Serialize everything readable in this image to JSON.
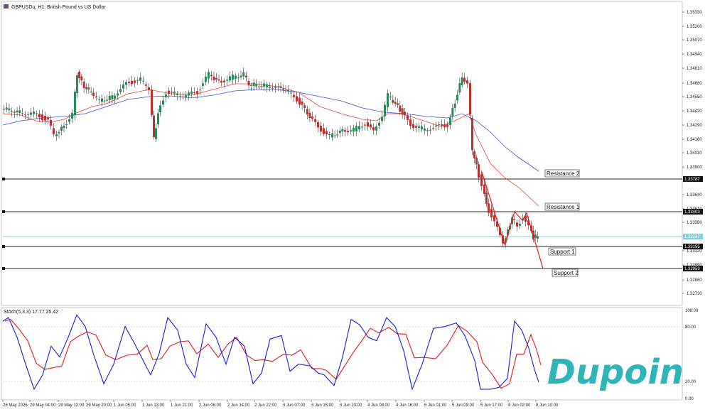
{
  "header": {
    "symbol_title": "GBPUSDu, H1: British Pound vs US Dollar"
  },
  "oscillator": {
    "title": "Stoch(5,3,3) 17.77 25.42",
    "levels": [
      "100.00",
      "80.00",
      "20.00",
      "0.00"
    ]
  },
  "price_axis": {
    "ticks": [
      "1.35330",
      "1.35200",
      "1.35070",
      "1.34940",
      "1.34810",
      "1.34680",
      "1.34550",
      "1.34420",
      "1.34290",
      "1.34160",
      "1.34030",
      "1.33900",
      "1.33640",
      "1.33510",
      "1.33380",
      "1.33120",
      "1.32990",
      "1.32860",
      "1.32730"
    ]
  },
  "level_labels": {
    "resistance2_price": "1.33787",
    "resistance1_price": "1.33403",
    "current_price": "1.33247",
    "support1_price": "1.33155",
    "support2_price": "1.32953"
  },
  "annotations": {
    "resistance2": "Resistance 2",
    "resistance1": "Resistance 1",
    "support1": "Support 1",
    "support2": "Support 2"
  },
  "time_axis": {
    "ticks": [
      "28 May 2026",
      "29 May 04:00",
      "29 May 12:00",
      "29 May 20:00",
      "1 Jun 05:00",
      "1 Jun 13:00",
      "1 Jun 21:00",
      "2 Jun 06:00",
      "2 Jun 14:00",
      "2 Jun 22:00",
      "3 Jun 07:00",
      "3 Jun 15:00",
      "3 Jun 23:00",
      "4 Jun 08:00",
      "4 Jun 16:00",
      "5 Jun 01:00",
      "5 Jun 09:00",
      "5 Jun 17:00",
      "8 Jun 02:00",
      "8 Jun 10:00"
    ]
  },
  "logo": {
    "text": "Dupoin"
  },
  "colors": {
    "bull": "#2a8a5c",
    "bear": "#b83232",
    "ema_fast": "#e8413a",
    "ema_slow": "#3a4fd8",
    "current_line": "#7fd0dc",
    "stoch_main": "#1a1ad8",
    "stoch_signal": "#e01a1a",
    "logo": "#2fb5b8"
  }
}
